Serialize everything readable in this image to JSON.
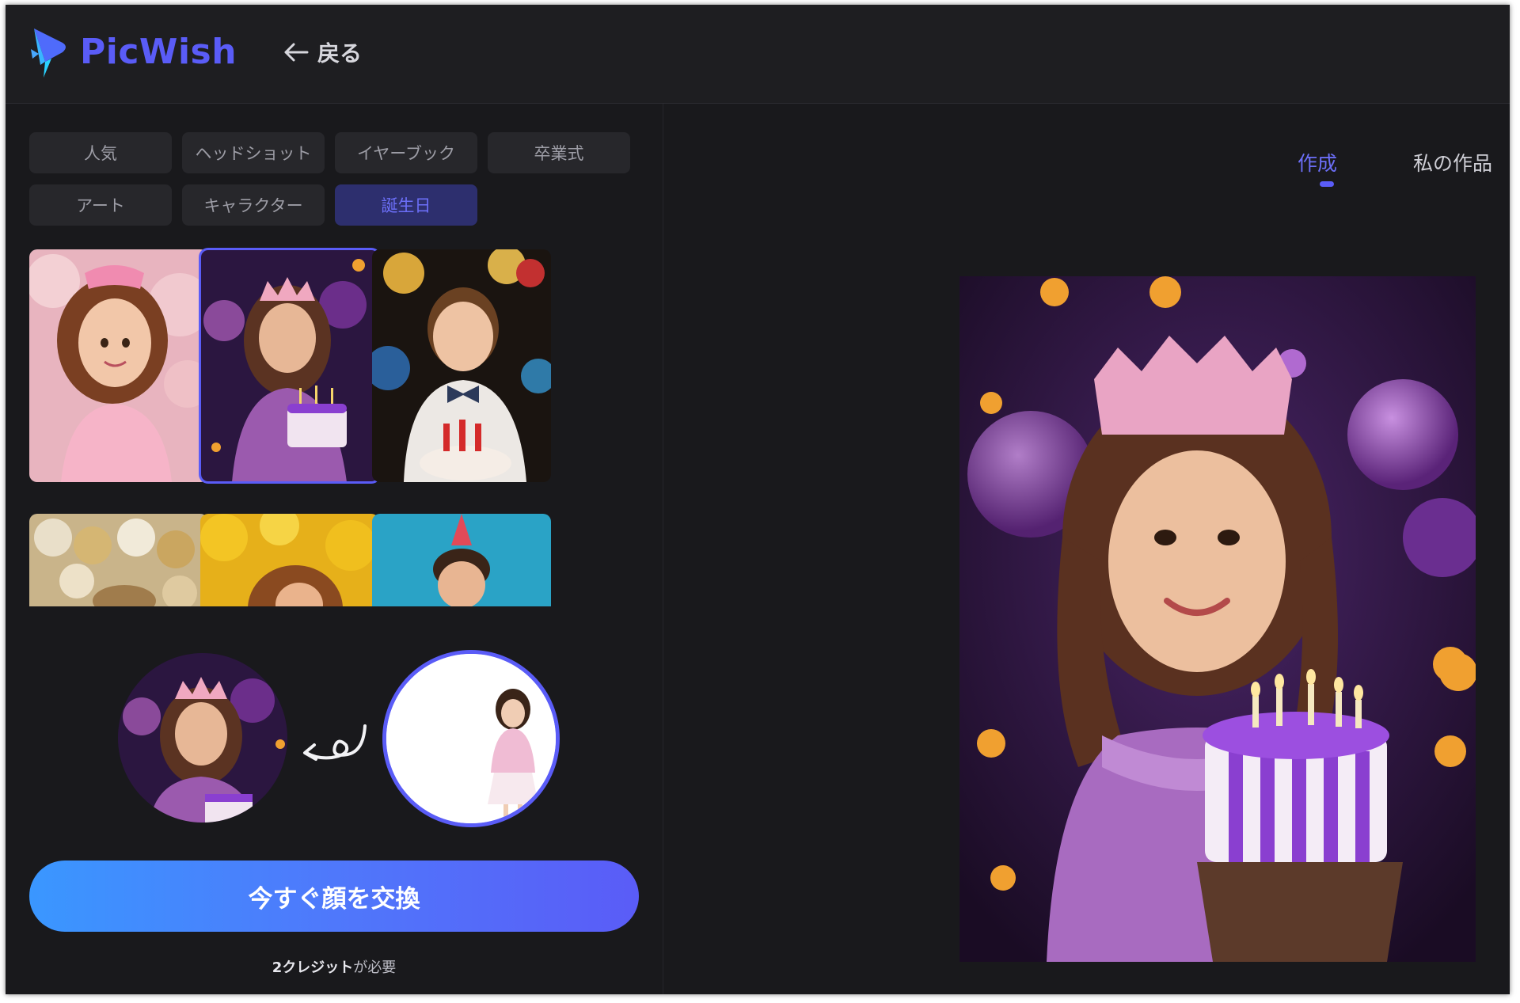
{
  "header": {
    "brand": "PicWish",
    "back_label": "戻る"
  },
  "categories": [
    {
      "label": "人気",
      "active": false
    },
    {
      "label": "ヘッドショット",
      "active": false
    },
    {
      "label": "イヤーブック",
      "active": false
    },
    {
      "label": "卒業式",
      "active": false
    },
    {
      "label": "アート",
      "active": false
    },
    {
      "label": "キャラクター",
      "active": false
    },
    {
      "label": "誕生日",
      "active": true
    }
  ],
  "templates": [
    {
      "name": "girl-pink-balloons",
      "selected": false
    },
    {
      "name": "girl-crown-cake",
      "selected": true
    },
    {
      "name": "boy-bowtie-cake",
      "selected": false
    },
    {
      "name": "gold-balloons",
      "selected": false
    },
    {
      "name": "yellow-balloons",
      "selected": false
    },
    {
      "name": "man-party-hat",
      "selected": false
    }
  ],
  "action": {
    "swap_button": "今すぐ顔を交換",
    "credit_amount": "2クレジット",
    "credit_suffix": "が必要"
  },
  "right": {
    "tabs": [
      {
        "label": "作成",
        "active": true
      },
      {
        "label": "私の作品",
        "active": false
      }
    ]
  },
  "colors": {
    "accent": "#5a5cf7",
    "background": "#19191c",
    "chip": "#27272b",
    "cta_start": "#3a97ff",
    "cta_end": "#5a5cf7"
  }
}
